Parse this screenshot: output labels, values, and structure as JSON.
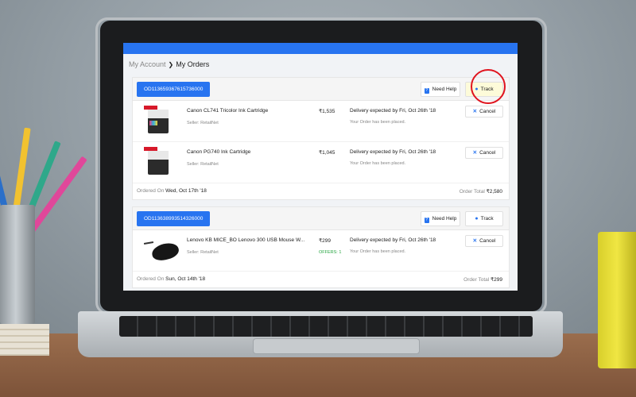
{
  "breadcrumb": {
    "parent": "My Account",
    "current": "My Orders"
  },
  "actions": {
    "need_help": "Need Help",
    "track": "Track",
    "cancel": "Cancel"
  },
  "orders": [
    {
      "id": "OD113659367615736000",
      "items": [
        {
          "name": "Canon CL741 Tricolor Ink Cartridge",
          "seller": "Seller: RetailNet",
          "price": "₹1,535",
          "delivery": "Delivery expected by Fri, Oct 26th '18",
          "status": "Your Order has been placed."
        },
        {
          "name": "Canon PG740 Ink Cartridge",
          "seller": "Seller: RetailNet",
          "price": "₹1,045",
          "delivery": "Delivery expected by Fri, Oct 26th '18",
          "status": "Your Order has been placed."
        }
      ],
      "ordered_on_label": "Ordered On",
      "ordered_on": "Wed, Oct 17th '18",
      "total_label": "Order Total",
      "total": "₹2,580"
    },
    {
      "id": "OD113638993514326000",
      "items": [
        {
          "name": "Lenovo KB MICE_BO Lenovo 300 USB Mouse W...",
          "seller": "Seller: RetailNet",
          "price": "₹299",
          "offers": "OFFERS: 1",
          "delivery": "Delivery expected by Fri, Oct 26th '18",
          "status": "Your Order has been placed."
        }
      ],
      "ordered_on_label": "Ordered On",
      "ordered_on": "Sun, Oct 14th '18",
      "total_label": "Order Total",
      "total": "₹299"
    }
  ],
  "colors": {
    "brand": "#2874f0",
    "offer": "#26a541",
    "highlight_circle": "#e0141e"
  }
}
